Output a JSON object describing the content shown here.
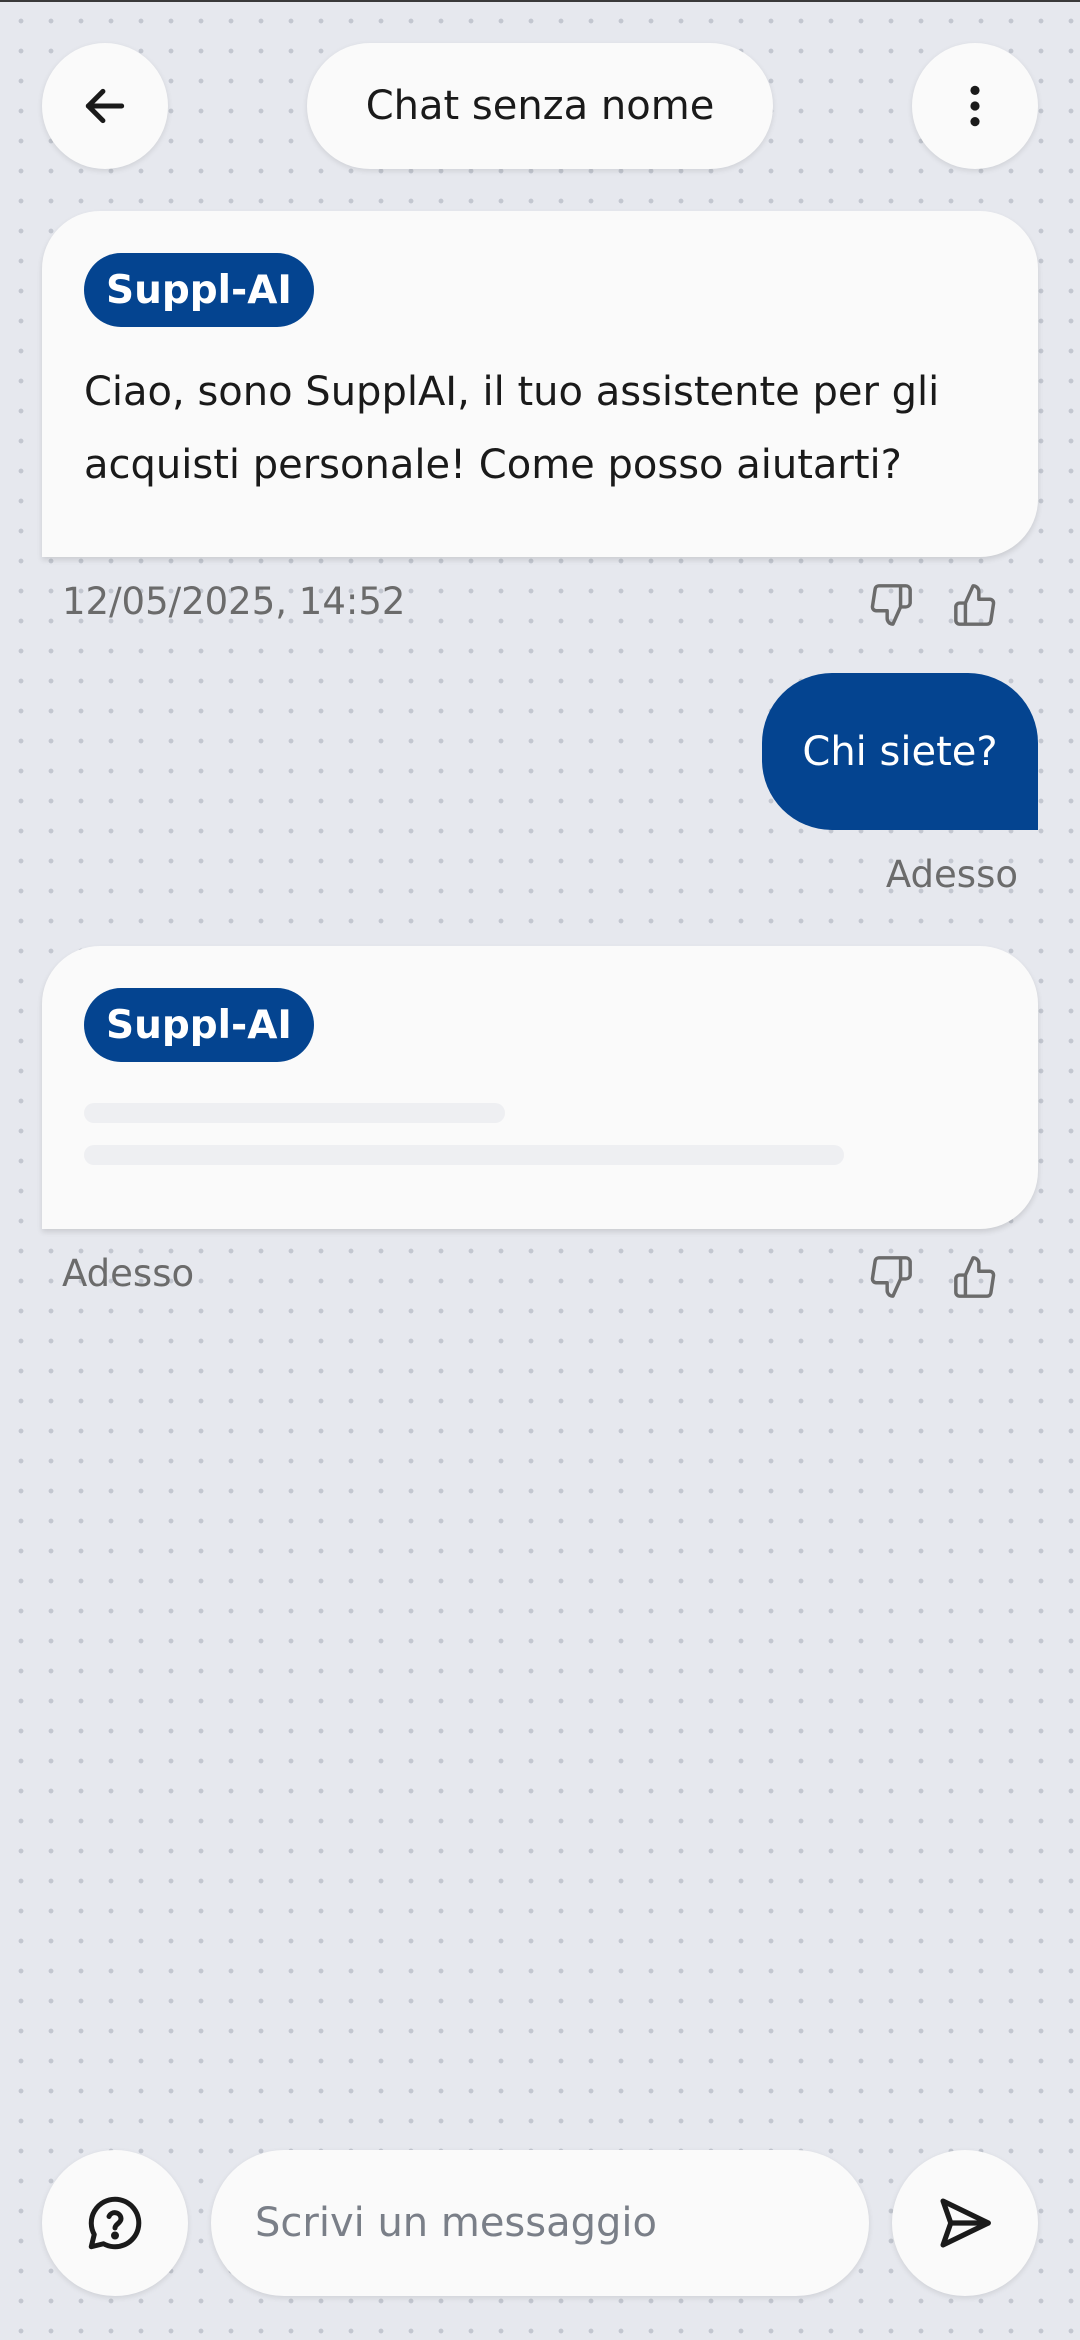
{
  "header": {
    "title": "Chat senza nome",
    "back_icon": "arrow-left-icon",
    "menu_icon": "more-vertical-icon"
  },
  "messages": [
    {
      "sender": "Suppl-AI",
      "text": "Ciao, sono SupplAI, il tuo assistente per gli acquisti personale! Come posso aiutarti?",
      "timestamp": "12/05/2025, 14:52"
    },
    {
      "sender": "user",
      "text": "Chi siete?",
      "timestamp": "Adesso"
    },
    {
      "sender": "Suppl-AI",
      "text": "",
      "loading": true,
      "timestamp": "Adesso"
    }
  ],
  "composer": {
    "placeholder": "Scrivi un messaggio",
    "help_icon": "help-chat-icon",
    "send_icon": "send-icon"
  },
  "colors": {
    "brand": "#044490",
    "background": "#e6e8ee",
    "surface": "#fafafa"
  }
}
